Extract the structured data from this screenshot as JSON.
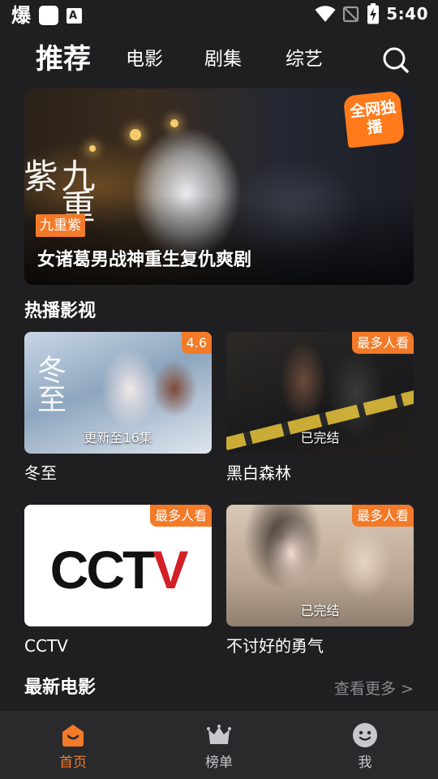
{
  "status_bar": {
    "left_char": "爆",
    "time": "5:40"
  },
  "top_nav": {
    "tabs": [
      {
        "label": "推荐",
        "active": true
      },
      {
        "label": "电影"
      },
      {
        "label": "剧集"
      },
      {
        "label": "综艺"
      }
    ]
  },
  "banner": {
    "logo_text": "九重紫",
    "badge": "全网独播",
    "tag": "九重紫",
    "title": "女诸葛男战神重生复仇爽剧"
  },
  "hot_section": {
    "title": "热播影视",
    "cards": [
      {
        "title": "冬至",
        "badge": "4.6",
        "status": "更新至16集",
        "art_text": "冬至"
      },
      {
        "title": "黑白森林",
        "badge": "最多人看",
        "status": "已完结"
      },
      {
        "title": "CCTV",
        "badge": "最多人看",
        "logo": "CCTV"
      },
      {
        "title": "不讨好的勇气",
        "badge": "最多人看",
        "status": "已完结"
      }
    ]
  },
  "new_movies": {
    "title": "最新电影",
    "more_label": "查看更多 >"
  },
  "bottom_nav": {
    "items": [
      {
        "label": "首页",
        "icon": "home-icon",
        "active": true
      },
      {
        "label": "榜单",
        "icon": "crown-icon"
      },
      {
        "label": "我",
        "icon": "smiley-icon"
      }
    ]
  },
  "colors": {
    "accent": "#f27a28",
    "background": "#1f1f21",
    "nav_background": "#2a2a2d",
    "muted_text": "#8a8a8e"
  }
}
